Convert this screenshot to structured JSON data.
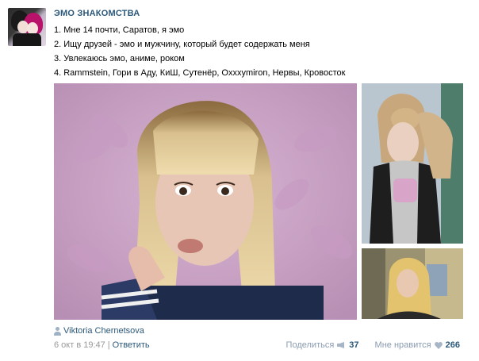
{
  "group": {
    "title": "ЭМО ЗНАКОМСТВА",
    "avatar_icon": "group-avatar"
  },
  "post": {
    "lines": [
      "1. Мне 14 почти, Саратов, я эмо",
      "2. Ищу друзей - эмо и мужчину, который будет содержать меня",
      "3. Увлекаюсь эмо, аниме, роком",
      "4. Rammstein, Гори в Аду, КиШ, Сутенёр, Oxxxymiron, Нервы, Кровосток"
    ],
    "photos": [
      "main-photo",
      "side-photo-1",
      "side-photo-2"
    ]
  },
  "author": {
    "icon": "user-icon",
    "name": "Viktoria Chernetsova"
  },
  "meta": {
    "date": "6 окт в 19:47",
    "separator": "|",
    "reply_label": "Ответить"
  },
  "actions": {
    "share_label": "Поделиться",
    "share_icon": "megaphone-icon",
    "share_count": "37",
    "like_label": "Мне нравится",
    "like_icon": "heart-icon",
    "like_count": "266"
  },
  "colors": {
    "link": "#2b587a",
    "muted": "#999999",
    "accent_muted": "#8a9bb0"
  }
}
